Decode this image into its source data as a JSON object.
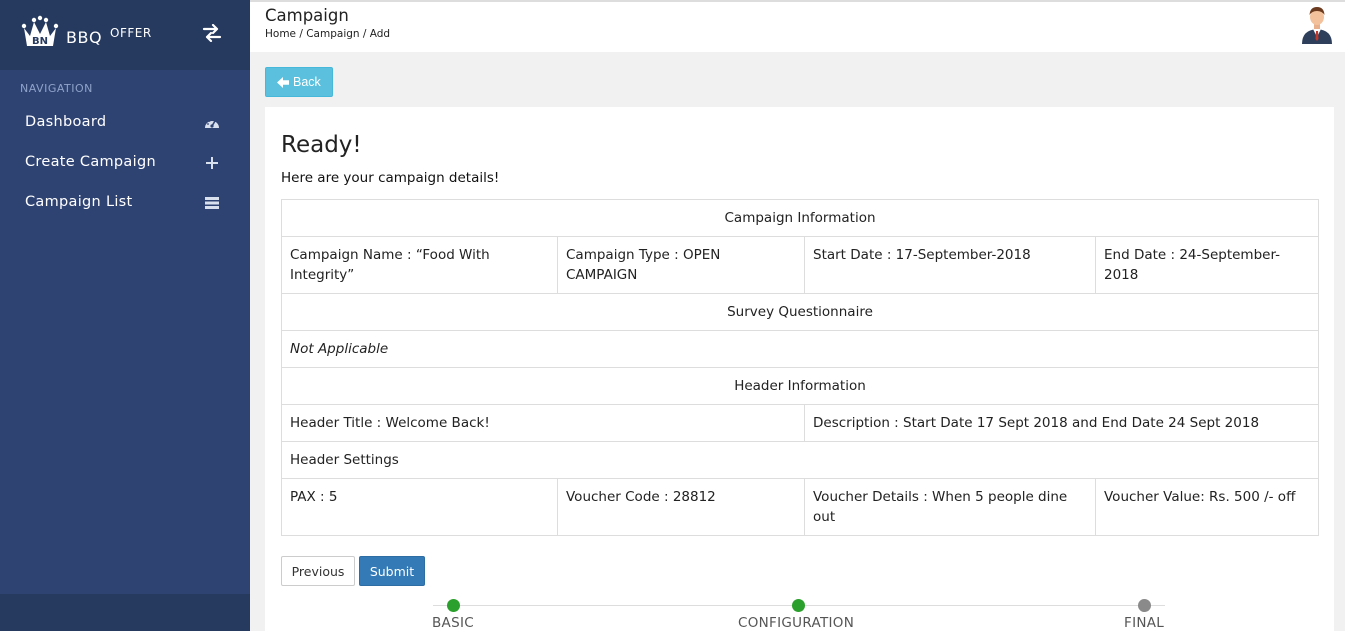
{
  "brand": {
    "name": "BBQ",
    "superscript": "OFFER",
    "logo_text": "BN"
  },
  "sidebar": {
    "heading": "NAVIGATION",
    "items": [
      {
        "label": "Dashboard",
        "icon": "dashboard-gauge-icon"
      },
      {
        "label": "Create Campaign",
        "icon": "plus-icon"
      },
      {
        "label": "Campaign List",
        "icon": "list-icon"
      }
    ]
  },
  "header": {
    "title": "Campaign",
    "breadcrumb": "Home / Campaign / Add"
  },
  "back_button": {
    "label": "Back"
  },
  "card": {
    "heading": "Ready!",
    "subheading": "Here are your campaign details!"
  },
  "details": {
    "campaign_info_title": "Campaign Information",
    "campaign_name": "Campaign Name : “Food With Integrity”",
    "campaign_type": "Campaign Type : OPEN CAMPAIGN",
    "start_date": "Start Date : 17-September-2018",
    "end_date": "End Date : 24-September-2018",
    "survey_title": "Survey Questionnaire",
    "survey_value": "Not Applicable",
    "header_info_title": "Header Information",
    "header_title": "Header Title : Welcome Back!",
    "description": "Description : Start Date 17 Sept 2018 and End Date 24 Sept 2018",
    "header_settings_title": "Header Settings",
    "pax": "PAX : 5",
    "voucher_code": "Voucher Code : 28812",
    "voucher_details": "Voucher Details : When 5 people dine out",
    "voucher_value": "Voucher Value: Rs. 500 /- off"
  },
  "actions": {
    "previous_label": "Previous",
    "submit_label": "Submit"
  },
  "stepper": {
    "steps": [
      {
        "label": "BASIC",
        "status": "complete"
      },
      {
        "label": "CONFIGURATION",
        "status": "complete"
      },
      {
        "label": "FINAL",
        "status": "pending"
      }
    ]
  },
  "colors": {
    "sidebar_bg": "#2f4373",
    "brand_bg": "#26395f",
    "back_button": "#5bc0de",
    "submit_button": "#337ab7",
    "step_complete": "#2ca02c",
    "step_pending": "#8a8a8a"
  }
}
